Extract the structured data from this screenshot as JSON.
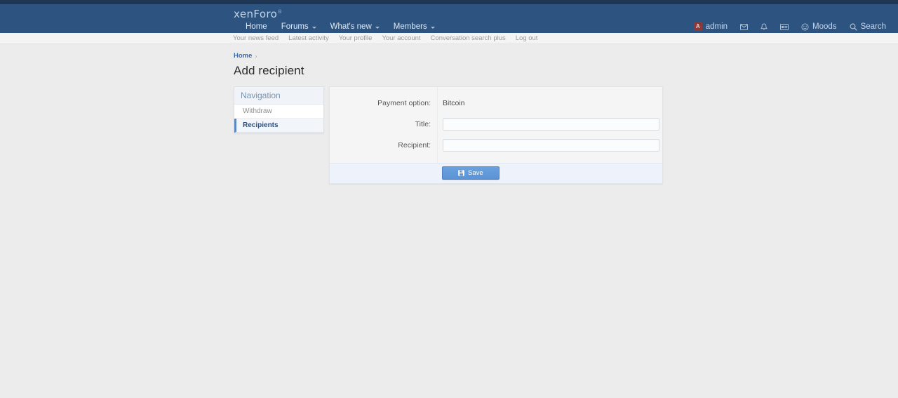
{
  "site": {
    "logo_text": "xenForo",
    "logo_mark": "®"
  },
  "header": {
    "nav_primary": [
      {
        "label": "Home",
        "has_caret": false
      },
      {
        "label": "Forums",
        "has_caret": true
      },
      {
        "label": "What's new",
        "has_caret": true
      },
      {
        "label": "Members",
        "has_caret": true
      }
    ],
    "user": {
      "avatar_initial": "A",
      "username": "admin"
    },
    "icons": [
      {
        "name": "inbox-icon"
      },
      {
        "name": "alerts-bell-icon"
      },
      {
        "name": "credit-card-icon"
      }
    ],
    "moods_label": "Moods",
    "search_label": "Search"
  },
  "nav_secondary": [
    "Your news feed",
    "Latest activity",
    "Your profile",
    "Your account",
    "Conversation search plus",
    "Log out"
  ],
  "breadcrumb": {
    "home": "Home",
    "separator": "›"
  },
  "page": {
    "title": "Add recipient"
  },
  "sidebar": {
    "header": "Navigation",
    "items": [
      {
        "label": "Withdraw",
        "active": false
      },
      {
        "label": "Recipients",
        "active": true
      }
    ]
  },
  "form": {
    "rows": [
      {
        "label": "Payment option:",
        "type": "static",
        "value": "Bitcoin"
      },
      {
        "label": "Title:",
        "type": "input",
        "value": "",
        "placeholder": ""
      },
      {
        "label": "Recipient:",
        "type": "input",
        "value": "",
        "placeholder": ""
      }
    ],
    "save_label": "Save"
  },
  "colors": {
    "header_blue": "#2d5380",
    "top_strip": "#1f3755",
    "page_bg": "#ececec",
    "accent_link": "#3b6ba5",
    "button_blue": "#5b93d6",
    "active_border": "#5b87c4"
  }
}
